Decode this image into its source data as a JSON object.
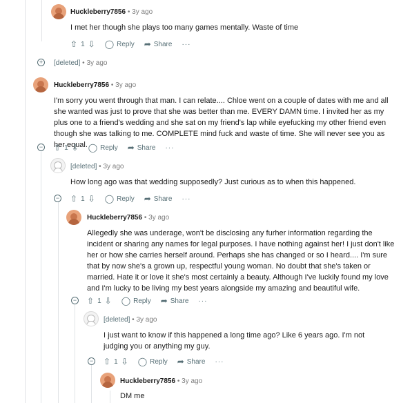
{
  "comments": [
    {
      "author": "Huckleberry7856",
      "age": "3y ago",
      "text": "I met her though she plays too many games mentally. Waste of time",
      "score": "1"
    },
    {
      "author": "[deleted]",
      "age": "3y ago"
    },
    {
      "author": "Huckleberry7856",
      "age": "3y ago",
      "text": "I'm sorry you went through that man. I can relate.... Chloe went on a couple of dates with me and all she wanted was just to prove that she was better than me. EVERY DAMN time. I invited her as my plus one to a friend's wedding and she sat on my friend's lap while eyefucking my other friend even though she was talking to me. COMPLETE mind fuck and waste of time. She will never see you as her equal.",
      "score": "1"
    },
    {
      "author": "[deleted]",
      "age": "3y ago",
      "text": "How long ago was that wedding supposedly? Just curious as to when this happened.",
      "score": "1"
    },
    {
      "author": "Huckleberry7856",
      "age": "3y ago",
      "text": "Allegedly she was underage, won't be disclosing any furher information regarding the incident or sharing any names for legal purposes. I have nothing against her! I just don't like her or how she carries herself around. Perhaps she has changed or so I heard.... I'm sure that by now she's a grown up, respectful young woman. No doubt that she's taken or married. Hate it or love it she's most certainly a beauty. Although I've luckily found my love and I'm lucky to be living my best years alongside my amazing and beautiful wife.",
      "score": "1"
    },
    {
      "author": "[deleted]",
      "age": "3y ago",
      "text": "I just want to know if this happened a long time ago? Like 6 years ago. I'm not judging you or anything my guy.",
      "score": "1"
    },
    {
      "author": "Huckleberry7856",
      "age": "3y ago",
      "text": "DM me"
    }
  ],
  "labels": {
    "reply": "Reply",
    "share": "Share",
    "dot": "•",
    "more": "···"
  },
  "icons": [
    "upvote-icon",
    "downvote-icon",
    "reply-icon",
    "share-icon",
    "collapse-icon",
    "expand-icon"
  ]
}
